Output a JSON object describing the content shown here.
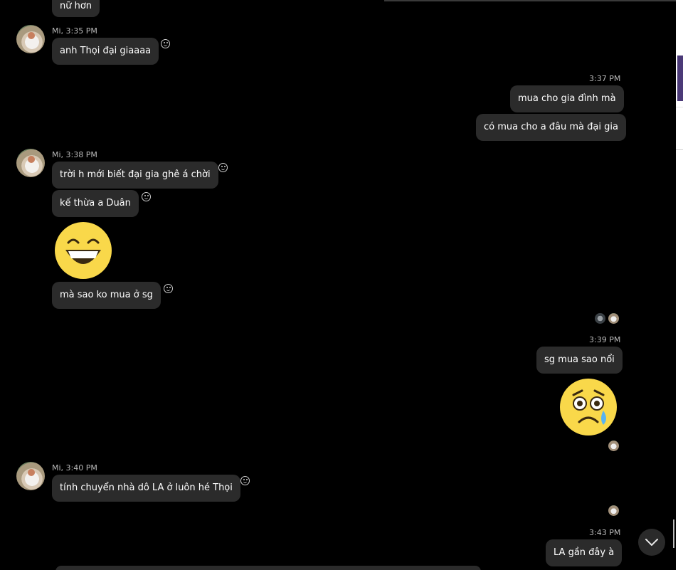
{
  "messages": {
    "prev_text": "nữ hơn",
    "g1": {
      "sender_time": "Mi, 3:35 PM",
      "text": "anh Thọi đại giaaaa"
    },
    "me1": {
      "time": "3:37 PM",
      "texts": [
        "mua cho gia đình mà",
        "có mua cho a đâu mà đại gia"
      ]
    },
    "g2": {
      "sender_time": "Mi, 3:38 PM",
      "texts": [
        "trời h mới biết đại gia ghê á chời",
        "kế thừa a Duân",
        "mà sao ko mua ở sg"
      ],
      "emoji": "grinning-face"
    },
    "me2": {
      "time": "3:39 PM",
      "text": "sg mua sao nổi",
      "emoji": "sad-tear-face"
    },
    "g3": {
      "sender_time": "Mi, 3:40 PM",
      "text": "tính chuyển nhà dô LA ở luôn hé Thọi"
    },
    "me3": {
      "time": "3:43 PM",
      "text": "LA gần đây à"
    }
  },
  "icons": {
    "reaction": "smile-icon",
    "scroll_down": "chevron-down-icon"
  },
  "colors": {
    "background": "#000000",
    "bubble": "#2b2b2b",
    "meta_text": "#b9b9b9",
    "accent": "#4b3a78"
  }
}
